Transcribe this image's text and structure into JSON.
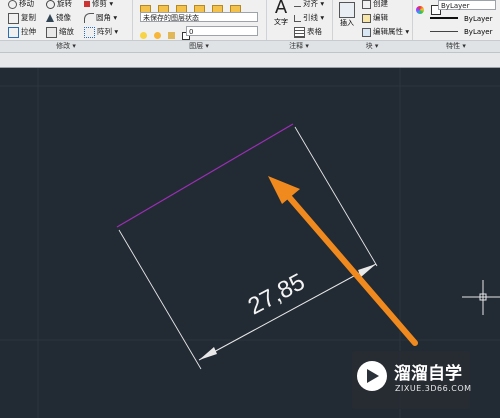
{
  "ribbon": {
    "modify": {
      "footer": "修改 ▾",
      "tools": [
        "移动",
        "旋转",
        "修剪 ▾",
        "复制",
        "镜像",
        "圆角 ▾",
        "拉伸",
        "缩放",
        "阵列 ▾"
      ]
    },
    "layers": {
      "footer": "图层 ▾",
      "layer_state": "未保存的图层状态",
      "current_layer": "0"
    },
    "annotation": {
      "footer": "注释 ▾",
      "text_label": "文字",
      "align_label": "对齐 ▾",
      "leader_label": "引线 ▾",
      "table_label": "表格"
    },
    "block": {
      "footer": "块 ▾",
      "insert_label": "插入",
      "create_label": "创建",
      "edit_label": "编辑",
      "edit_attr_label": "编辑属性 ▾"
    },
    "properties": {
      "footer": "特性 ▾",
      "color": "ByLayer",
      "linetype": "ByLayer",
      "lineweight": "ByLayer"
    }
  },
  "drawing": {
    "dimension_text": "27,85",
    "line_color": "#9b2fb5",
    "arrow_color": "#f08a1e"
  },
  "watermark": {
    "title": "溜溜自学",
    "url": "ZIXUE.3D66.COM"
  }
}
